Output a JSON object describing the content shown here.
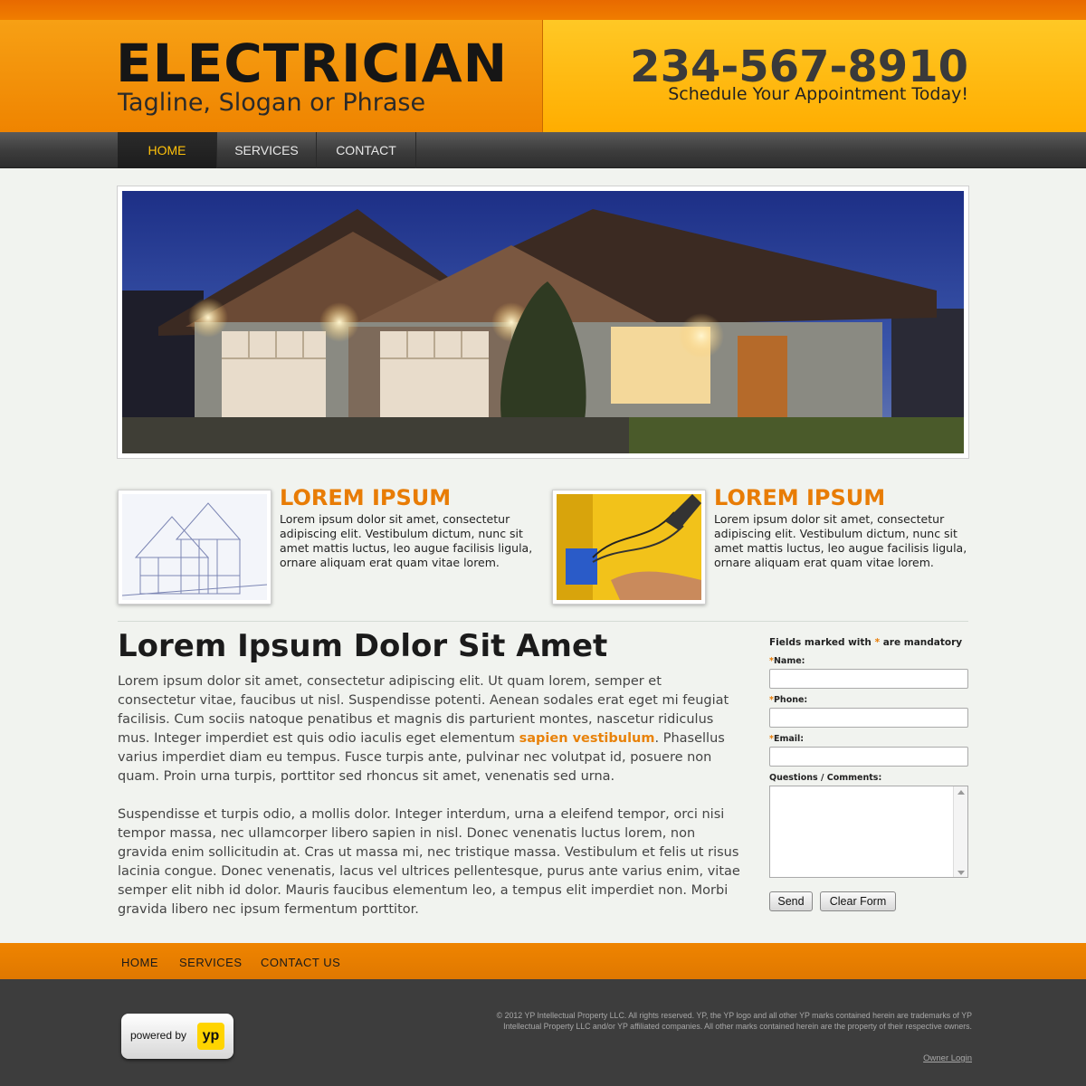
{
  "header": {
    "logo_title": "ELECTRICIAN",
    "tagline": "Tagline, Slogan or Phrase",
    "phone": "234-567-8910",
    "schedule": "Schedule Your Appointment Today!"
  },
  "nav": {
    "items": [
      {
        "label": "HOME",
        "active": true
      },
      {
        "label": "SERVICES",
        "active": false
      },
      {
        "label": "CONTACT",
        "active": false
      }
    ]
  },
  "features": [
    {
      "title": "LOREM IPSUM",
      "text": "Lorem ipsum dolor sit amet, consectetur adipiscing elit. Vestibulum dictum, nunc sit amet mattis luctus, leo augue facilisis ligula, ornare aliquam erat quam vitae lorem.",
      "image": "house-blueprint"
    },
    {
      "title": "LOREM IPSUM",
      "text": "Lorem ipsum dolor sit amet, consectetur adipiscing elit. Vestibulum dictum, nunc sit amet mattis luctus, leo augue facilisis ligula, ornare aliquam erat quam vitae lorem.",
      "image": "electrician-wiring"
    }
  ],
  "main": {
    "title": "Lorem Ipsum Dolor Sit Amet",
    "para1_before": "Lorem ipsum dolor sit amet, consectetur adipiscing elit. Ut quam lorem, semper et consectetur vitae, faucibus ut nisl. Suspendisse potenti. Aenean sodales erat eget mi feugiat facilisis. Cum sociis natoque penatibus et magnis dis parturient montes, nascetur ridiculus mus. Integer imperdiet est quis odio iaculis eget elementum ",
    "para1_highlight": "sapien vestibulum",
    "para1_after": ". Phasellus varius imperdiet diam eu tempus. Fusce turpis ante, pulvinar nec volutpat id, posuere non quam. Proin urna turpis, porttitor sed rhoncus sit amet, venenatis sed urna.",
    "para2": "Suspendisse et turpis odio, a mollis dolor. Integer interdum, urna a eleifend tempor, orci nisi tempor massa, nec ullamcorper libero sapien in nisl. Donec venenatis luctus lorem, non gravida enim sollicitudin at. Cras ut massa mi, nec tristique massa. Vestibulum et felis ut risus lacinia congue. Donec venenatis, lacus vel ultrices pellentesque, purus ante varius enim, vitae semper elit nibh id dolor. Mauris faucibus elementum leo, a tempus elit imperdiet non. Morbi gravida libero nec ipsum fermentum porttitor."
  },
  "form": {
    "note_before": "Fields marked with ",
    "note_star": "*",
    "note_after": " are mandatory",
    "fields": [
      {
        "label": "Name:",
        "required": true,
        "value": ""
      },
      {
        "label": "Phone:",
        "required": true,
        "value": ""
      },
      {
        "label": "Email:",
        "required": true,
        "value": ""
      }
    ],
    "comments_label": "Questions / Comments:",
    "comments_value": "",
    "send_label": "Send",
    "clear_label": "Clear Form"
  },
  "footer_nav": {
    "items": [
      "HOME",
      "SERVICES",
      "CONTACT US"
    ]
  },
  "footer": {
    "badge_text": "powered by",
    "badge_logo": "yp",
    "copyright": "© 2012  YP Intellectual Property LLC. All rights reserved. YP, the YP logo and all other YP marks contained herein are trademarks of YP Intellectual Property LLC and/or YP affiliated companies. All other marks contained herein are the property of their respective owners.",
    "owner_login": "Owner Login"
  },
  "colors": {
    "accent": "#e87c05",
    "header_orange": "#f08a00",
    "header_yellow": "#ffb400",
    "nav_dark": "#3c3c3c",
    "footer_dark": "#3d3d3d"
  }
}
